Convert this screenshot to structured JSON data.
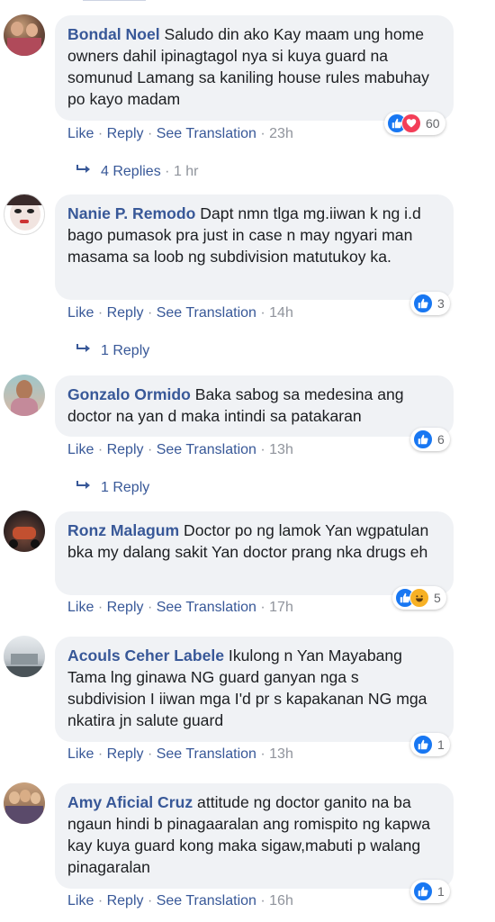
{
  "comments": [
    {
      "author": "Bondal Noel",
      "text": " Saludo din ako Kay maam ung home owners dahil ipinagtagol nya si kuya guard na somunud Lamang sa kaniling house rules mabuhay po kayo madam",
      "like": "Like",
      "reply": "Reply",
      "translate": "See Translation",
      "time": "23h",
      "reactions": [
        "like",
        "love"
      ],
      "reaction_count": "60",
      "replies_label": "4 Replies",
      "replies_time": "1 hr"
    },
    {
      "author": "Nanie P. Remodo",
      "text": " Dapt nmn tlga mg.iiwan k ng i.d bago pumasok pra just in case n may ngyari man masama sa loob ng subdivision matutukoy ka.",
      "like": "Like",
      "reply": "Reply",
      "translate": "See Translation",
      "time": "14h",
      "reactions": [
        "like"
      ],
      "reaction_count": "3",
      "replies_label": "1 Reply",
      "replies_time": ""
    },
    {
      "author": "Gonzalo Ormido",
      "text": " Baka sabog sa medesina ang doctor na yan d maka intindi sa patakaran",
      "like": "Like",
      "reply": "Reply",
      "translate": "See Translation",
      "time": "13h",
      "reactions": [
        "like"
      ],
      "reaction_count": "6",
      "replies_label": "1 Reply",
      "replies_time": ""
    },
    {
      "author": "Ronz Malagum",
      "text": " Doctor po ng lamok Yan wgpatulan bka my dalang sakit Yan doctor prang nka drugs eh",
      "like": "Like",
      "reply": "Reply",
      "translate": "See Translation",
      "time": "17h",
      "reactions": [
        "like",
        "haha"
      ],
      "reaction_count": "5",
      "replies_label": "",
      "replies_time": ""
    },
    {
      "author": "Acouls Ceher Labele",
      "text": " Ikulong n Yan Mayabang Tama lng ginawa NG guard ganyan nga s subdivision I iiwan mga I'd pr s kapakanan NG mga nkatira jn salute guard",
      "like": "Like",
      "reply": "Reply",
      "translate": "See Translation",
      "time": "13h",
      "reactions": [
        "like"
      ],
      "reaction_count": "1",
      "replies_label": "",
      "replies_time": ""
    },
    {
      "author": "Amy Aficial Cruz",
      "text": " attitude ng doctor ganito na ba ngaun hindi b pinagaaralan ang romispito ng kapwa kay kuya guard kong maka sigaw,mabuti p walang pinagaralan",
      "like": "Like",
      "reply": "Reply",
      "translate": "See Translation",
      "time": "16h",
      "reactions": [
        "like"
      ],
      "reaction_count": "1",
      "replies_label": "",
      "replies_time": ""
    }
  ],
  "separator": "·",
  "colors": {
    "link": "#385898",
    "muted": "#90949c",
    "bubble": "#f0f2f5",
    "like": "#1877f2",
    "love": "#f33e58",
    "haha": "#f7b125"
  }
}
